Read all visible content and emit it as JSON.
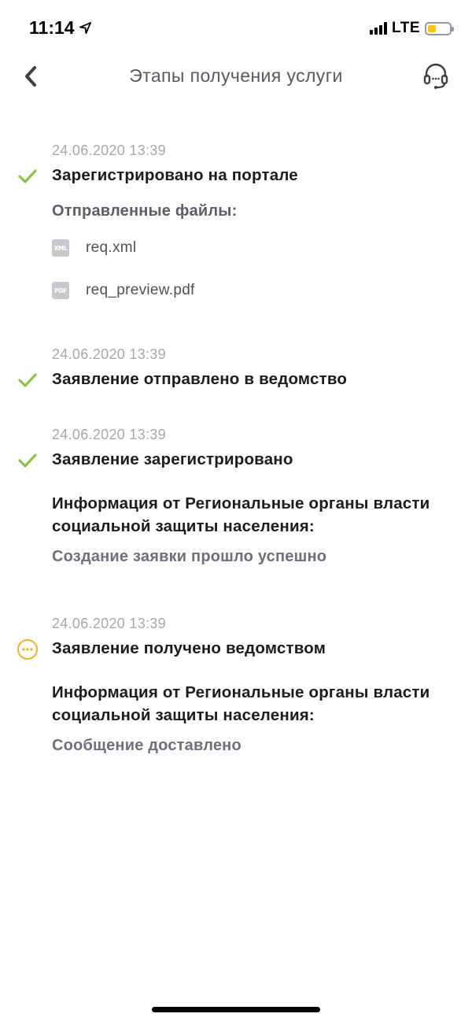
{
  "status_bar": {
    "time": "11:14",
    "network": "LTE",
    "battery_level": 0.4,
    "battery_color": "#f5c518"
  },
  "nav": {
    "title": "Этапы получения услуги",
    "back_icon": "chevron-left-icon",
    "support_icon": "headset-icon"
  },
  "colors": {
    "done": "#8bc34a",
    "pending": "#f0b429"
  },
  "stages": [
    {
      "date": "24.06.2020 13:39",
      "status": "done",
      "title": "Зарегистрировано на портале",
      "files_label": "Отправленные файлы:",
      "files": [
        {
          "type": "XML",
          "name": "req.xml"
        },
        {
          "type": "PDF",
          "name": "req_preview.pdf"
        }
      ]
    },
    {
      "date": "24.06.2020 13:39",
      "status": "done",
      "title": "Заявление отправлено в ведомство"
    },
    {
      "date": "24.06.2020 13:39",
      "status": "done",
      "title": "Заявление зарегистрировано",
      "info_heading": "Информация от Региональные органы власти социальной защиты населения:",
      "info_text": "Создание заявки прошло успешно"
    },
    {
      "date": "24.06.2020 13:39",
      "status": "pending",
      "title": "Заявление получено ведомством",
      "info_heading": "Информация от Региональные органы власти социальной защиты населения:",
      "info_text": "Сообщение доставлено"
    }
  ]
}
